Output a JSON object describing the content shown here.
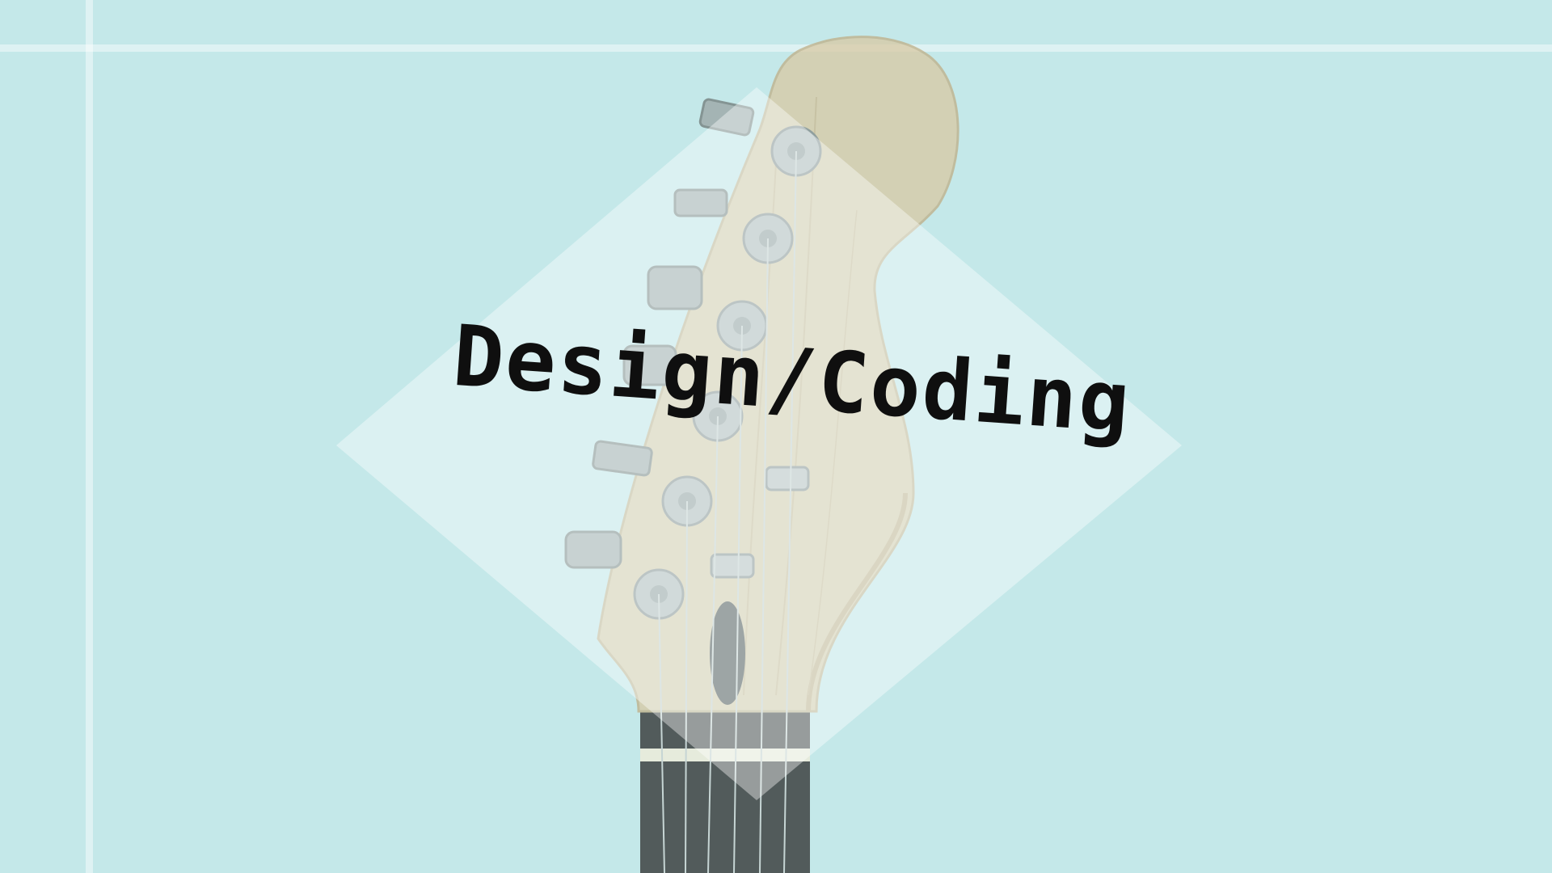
{
  "headline": {
    "text": "Design/Coding"
  },
  "colors": {
    "background": "#c4e8e9",
    "diamond": "#ffffff",
    "headline": "#0f0f0f",
    "wood": "#d9c9a3",
    "fretboard": "#2c2c2c",
    "hardware": "#9aa3a3"
  },
  "icons": {
    "guitar": "guitar-headstock-icon"
  }
}
